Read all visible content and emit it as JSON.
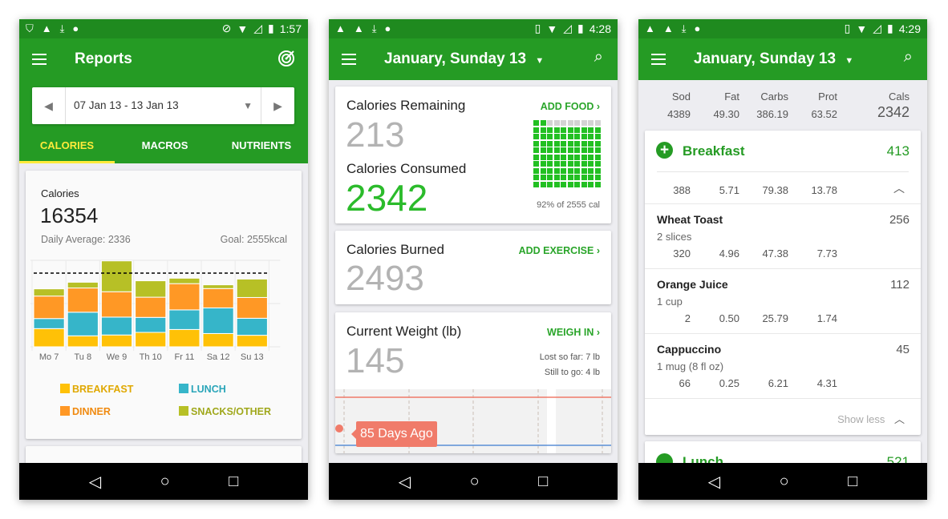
{
  "colors": {
    "primary": "#259b24",
    "status_bar": "#1f8a1f",
    "accent_tab": "#ffeb3b",
    "breakfast": "#ffc107",
    "lunch": "#36b5c9",
    "dinner": "#ff9825",
    "snacks": "#b7c026",
    "goal_line": "#000000",
    "weight_tooltip": "#f07b6a"
  },
  "screens": [
    {
      "status": {
        "time": "1:57",
        "left_icons": [
          "shield-icon",
          "warning-icon",
          "download-icon",
          "android-icon"
        ],
        "right_icons": [
          "do-not-disturb-icon",
          "wifi-icon",
          "signal-icon",
          "battery-charging-icon"
        ]
      },
      "title": "Reports",
      "action_icon": "target-icon",
      "date_range": "07 Jan 13 - 13 Jan 13",
      "tabs": [
        "CALORIES",
        "MACROS",
        "NUTRIENTS"
      ],
      "active_tab": 0,
      "summary": {
        "label": "Calories",
        "total": "16354",
        "daily_average": "Daily Average: 2336",
        "goal": "Goal: 2555kcal"
      },
      "legend": [
        "BREAKFAST",
        "LUNCH",
        "DINNER",
        "SNACKS/OTHER"
      ]
    },
    {
      "status": {
        "time": "4:28"
      },
      "title": "January, Sunday 13",
      "remaining": {
        "label": "Calories Remaining",
        "value": "213",
        "action": "ADD FOOD"
      },
      "consumed": {
        "label": "Calories Consumed",
        "value": "2342",
        "percent_text": "92% of 2555 cal",
        "percent": 92
      },
      "burned": {
        "label": "Calories Burned",
        "value": "2493",
        "action": "ADD EXERCISE"
      },
      "weight": {
        "label": "Current Weight (lb)",
        "value": "145",
        "action": "WEIGH IN",
        "lost": "Lost so far: 7 lb",
        "to_go": "Still to go: 4 lb",
        "tooltip": "85 Days Ago"
      }
    },
    {
      "status": {
        "time": "4:29"
      },
      "title": "January, Sunday 13",
      "totals": {
        "headers": [
          "Sod",
          "Fat",
          "Carbs",
          "Prot",
          "Cals"
        ],
        "values": [
          "4389",
          "49.30",
          "386.19",
          "63.52",
          "2342"
        ]
      },
      "breakfast": {
        "label": "Breakfast",
        "cals": "413",
        "macros": [
          "388",
          "5.71",
          "79.38",
          "13.78"
        ],
        "items": [
          {
            "name": "Wheat Toast",
            "serving": "2 slices",
            "cals": "256",
            "macros": [
              "320",
              "4.96",
              "47.38",
              "7.73"
            ]
          },
          {
            "name": "Orange Juice",
            "serving": "1 cup",
            "cals": "112",
            "macros": [
              "2",
              "0.50",
              "25.79",
              "1.74"
            ]
          },
          {
            "name": "Cappuccino",
            "serving": "1 mug (8 fl oz)",
            "cals": "45",
            "macros": [
              "66",
              "0.25",
              "6.21",
              "4.31"
            ]
          }
        ],
        "show_less": "Show less"
      },
      "next_meal": {
        "label": "Lunch",
        "cals": "521"
      }
    }
  ],
  "chart_data": {
    "type": "bar",
    "stacked": true,
    "categories": [
      "Mo 7",
      "Tu 8",
      "We 9",
      "Th 10",
      "Fr 11",
      "Sa 12",
      "Su 13"
    ],
    "series": [
      {
        "name": "BREAKFAST",
        "values": [
          630,
          380,
          410,
          500,
          600,
          460,
          400
        ]
      },
      {
        "name": "LUNCH",
        "values": [
          350,
          820,
          620,
          520,
          680,
          890,
          590
        ]
      },
      {
        "name": "DINNER",
        "values": [
          780,
          840,
          880,
          700,
          910,
          670,
          720
        ]
      },
      {
        "name": "SNACKS/OTHER",
        "values": [
          250,
          200,
          1070,
          570,
          190,
          130,
          640
        ]
      }
    ],
    "goal": 2555,
    "ylim": [
      0,
      3000
    ],
    "grid": true,
    "legend": "bottom"
  }
}
